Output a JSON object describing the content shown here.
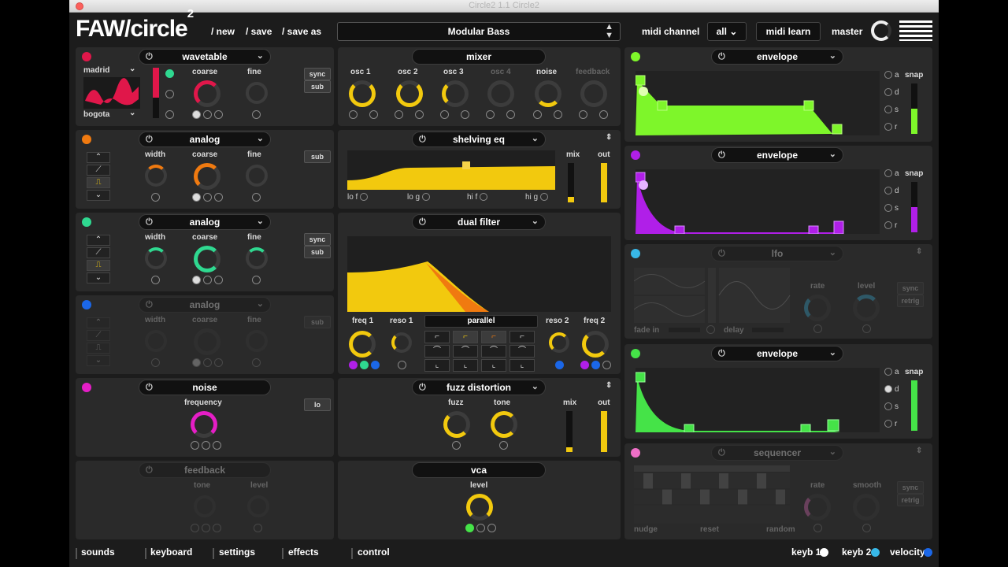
{
  "window": {
    "title": "Circle2 1.1 Circle2"
  },
  "header": {
    "logo": "FAW/circle",
    "logo_sup": "2",
    "new": "/ new",
    "save": "/ save",
    "save_as": "/ save as",
    "preset": "Modular Bass",
    "midi_channel_label": "midi channel",
    "midi_channel_value": "all",
    "midi_learn": "midi learn",
    "master": "master"
  },
  "osc1": {
    "title": "wavetable",
    "wave_top": "madrid",
    "wave_bottom": "bogota",
    "coarse": "coarse",
    "fine": "fine",
    "sync": "sync",
    "sub": "sub"
  },
  "osc2": {
    "title": "analog",
    "width": "width",
    "coarse": "coarse",
    "fine": "fine",
    "sub": "sub"
  },
  "osc3": {
    "title": "analog",
    "width": "width",
    "coarse": "coarse",
    "fine": "fine",
    "sync": "sync",
    "sub": "sub"
  },
  "osc4": {
    "title": "analog",
    "width": "width",
    "coarse": "coarse",
    "fine": "fine",
    "sub": "sub"
  },
  "noise": {
    "title": "noise",
    "frequency": "frequency",
    "lo": "lo"
  },
  "feedback": {
    "title": "feedback",
    "tone": "tone",
    "level": "level"
  },
  "mixer": {
    "title": "mixer",
    "ch1": "osc 1",
    "ch2": "osc 2",
    "ch3": "osc 3",
    "ch4": "osc 4",
    "ch5": "noise",
    "ch6": "feedback"
  },
  "shelving_eq": {
    "title": "shelving eq",
    "mix": "mix",
    "out": "out",
    "lo_f": "lo f",
    "lo_g": "lo g",
    "hi_f": "hi f",
    "hi_g": "hi g"
  },
  "dual_filter": {
    "title": "dual filter",
    "freq1": "freq 1",
    "reso1": "reso 1",
    "mode": "parallel",
    "reso2": "reso 2",
    "freq2": "freq 2"
  },
  "fuzz": {
    "title": "fuzz distortion",
    "fuzz": "fuzz",
    "tone": "tone",
    "mix": "mix",
    "out": "out"
  },
  "vca": {
    "title": "vca",
    "level": "level"
  },
  "env1": {
    "title": "envelope",
    "a": "a",
    "d": "d",
    "s": "s",
    "r": "r",
    "snap": "snap"
  },
  "env2": {
    "title": "envelope",
    "a": "a",
    "d": "d",
    "s": "s",
    "r": "r",
    "snap": "snap"
  },
  "lfo": {
    "title": "lfo",
    "fade_in": "fade in",
    "delay": "delay",
    "rate": "rate",
    "level": "level",
    "sync": "sync",
    "retrig": "retrig"
  },
  "env3": {
    "title": "envelope",
    "a": "a",
    "d": "d",
    "s": "s",
    "r": "r",
    "snap": "snap"
  },
  "sequencer": {
    "title": "sequencer",
    "rate": "rate",
    "smooth": "smooth",
    "sync": "sync",
    "retrig": "retrig",
    "foot1": "nudge",
    "foot2": "reset",
    "foot3": "random"
  },
  "bottom": {
    "sounds": "sounds",
    "keyboard": "keyboard",
    "settings": "settings",
    "effects": "effects",
    "control": "control",
    "keyb1": "keyb 1",
    "keyb2": "keyb 2",
    "velocity": "velocity"
  },
  "colors": {
    "osc1": "#e0174a",
    "osc2": "#f07a10",
    "osc3": "#2fd890",
    "osc4": "#1b67e8",
    "noise": "#e51ec6",
    "yellow": "#f2c90e",
    "env1": "#7ef62a",
    "env2": "#b01fe8",
    "lfo": "#38b8e8",
    "env3": "#45e348",
    "seq": "#ef6fc7"
  }
}
